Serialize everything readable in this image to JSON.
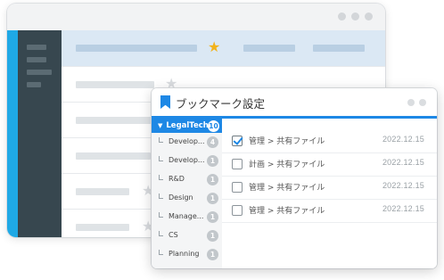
{
  "dialog": {
    "title": "ブックマーク設定",
    "folders": {
      "root": {
        "label": "LegalTech",
        "count": "10"
      },
      "items": [
        {
          "label": "Develop...",
          "count": "4"
        },
        {
          "label": "Develop...",
          "count": "1"
        },
        {
          "label": "R&D",
          "count": "1"
        },
        {
          "label": "Design",
          "count": "1"
        },
        {
          "label": "Manage...",
          "count": "1"
        },
        {
          "label": "CS",
          "count": "1"
        },
        {
          "label": "Planning",
          "count": "1"
        }
      ]
    },
    "bookmarks": [
      {
        "path": "管理 > 共有ファイル",
        "date": "2022.12.15",
        "checked": true
      },
      {
        "path": "計画 > 共有ファイル",
        "date": "2022.12.15",
        "checked": false
      },
      {
        "path": "管理 > 共有ファイル",
        "date": "2022.12.15",
        "checked": false
      },
      {
        "path": "管理 > 共有ファイル",
        "date": "2022.12.15",
        "checked": false
      }
    ]
  },
  "background_app": {
    "rows": [
      {
        "starred": true,
        "selected": true
      },
      {
        "starred": false,
        "selected": false
      },
      {
        "starred": false,
        "selected": false
      },
      {
        "starred": false,
        "selected": false
      },
      {
        "starred": false,
        "selected": false
      },
      {
        "starred": false,
        "selected": false
      }
    ]
  },
  "colors": {
    "accent": "#1e88e5",
    "sidebar_stripe": "#1fa9e6",
    "sidebar": "#37474f",
    "star_active": "#f2b31b",
    "selected_row": "#dbe8f4"
  },
  "icons": {
    "bookmark": "bookmark-icon",
    "star": "star-icon",
    "check": "checkbox-checked-icon"
  }
}
